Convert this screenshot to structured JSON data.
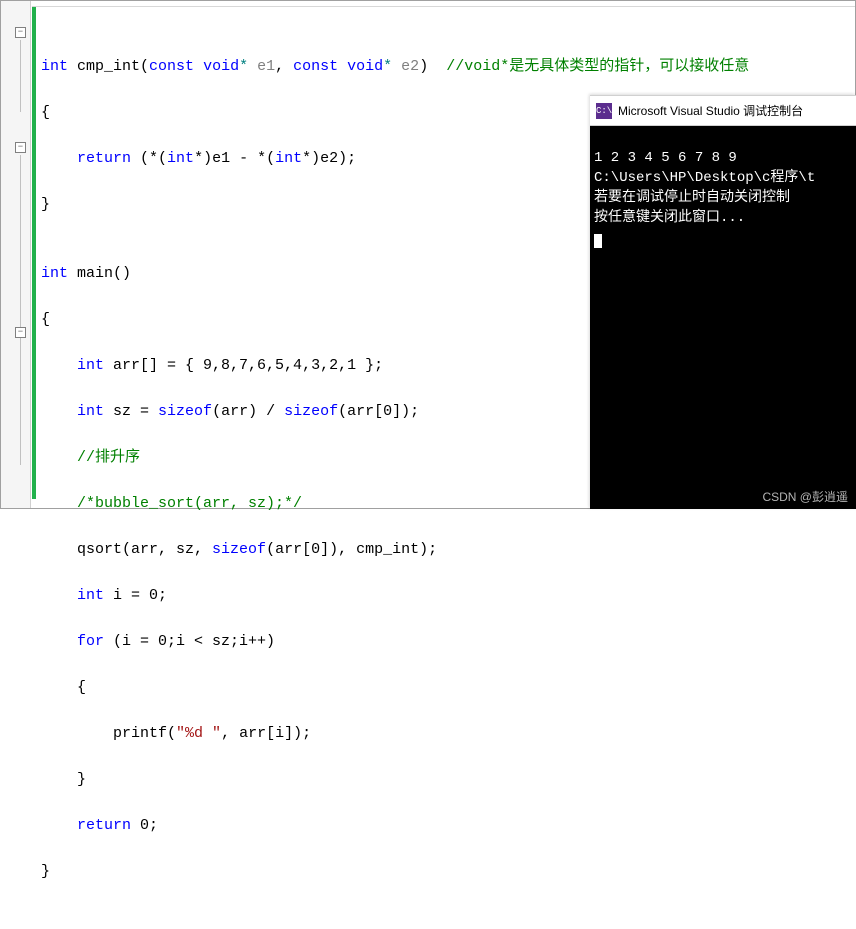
{
  "code": {
    "l1_int": "int",
    "l1_name": " cmp_int",
    "l1_paren1": "(",
    "l1_const1": "const",
    "l1_void1": " void",
    "l1_star1": "*",
    "l1_e1": " e1",
    "l1_comma": ", ",
    "l1_const2": "const",
    "l1_void2": " void",
    "l1_star2": "*",
    "l1_e2": " e2",
    "l1_paren2": ")  ",
    "l1_comment": "//void*是无具体类型的指针，可以接收任意",
    "l2": "{",
    "l3_indent": "    ",
    "l3_return": "return",
    "l3_body1": " (*(",
    "l3_int1": "int",
    "l3_body2": "*)e1 - *(",
    "l3_int2": "int",
    "l3_body3": "*)e2);",
    "l4": "}",
    "l5": "",
    "l6_int": "int",
    "l6_main": " main",
    "l6_par": "()",
    "l7": "{",
    "l8_indent": "    ",
    "l8_int": "int",
    "l8_arr": " arr[] = { 9,8,7,6,5,4,3,2,1 };",
    "l9_indent": "    ",
    "l9_int": "int",
    "l9_sz": " sz = ",
    "l9_sizeof1": "sizeof",
    "l9_mid": "(arr) / ",
    "l9_sizeof2": "sizeof",
    "l9_end": "(arr[0]);",
    "l10_indent": "    ",
    "l10_comment": "//排升序",
    "l11_indent": "    ",
    "l11_comment": "/*bubble_sort(arr, sz);*/",
    "l12_indent": "    ",
    "l12_qsort": "qsort",
    "l12_a": "(arr, sz, ",
    "l12_sizeof": "sizeof",
    "l12_b": "(arr[0]), cmp_int);",
    "l13_indent": "    ",
    "l13_int": "int",
    "l13_rest": " i = 0;",
    "l14_indent": "    ",
    "l14_for": "for",
    "l14_rest": " (i = 0;i < sz;i++)",
    "l15_indent": "    ",
    "l15": "{",
    "l16_indent": "        ",
    "l16_printf": "printf",
    "l16_a": "(",
    "l16_fmt": "\"%d \"",
    "l16_b": ", arr[i]);",
    "l17_indent": "    ",
    "l17": "}",
    "l18_indent": "    ",
    "l18_return": "return",
    "l18_rest": " 0;",
    "l19": "}"
  },
  "fold_glyph": "−",
  "console": {
    "icon": "C:\\",
    "title": "Microsoft Visual Studio 调试控制台",
    "line1": "1 2 3 4 5 6 7 8 9",
    "line2": "C:\\Users\\HP\\Desktop\\c程序\\t",
    "line3": "若要在调试停止时自动关闭控制",
    "line4": "按任意键关闭此窗口..."
  },
  "watermark": "CSDN @彭逍遥"
}
